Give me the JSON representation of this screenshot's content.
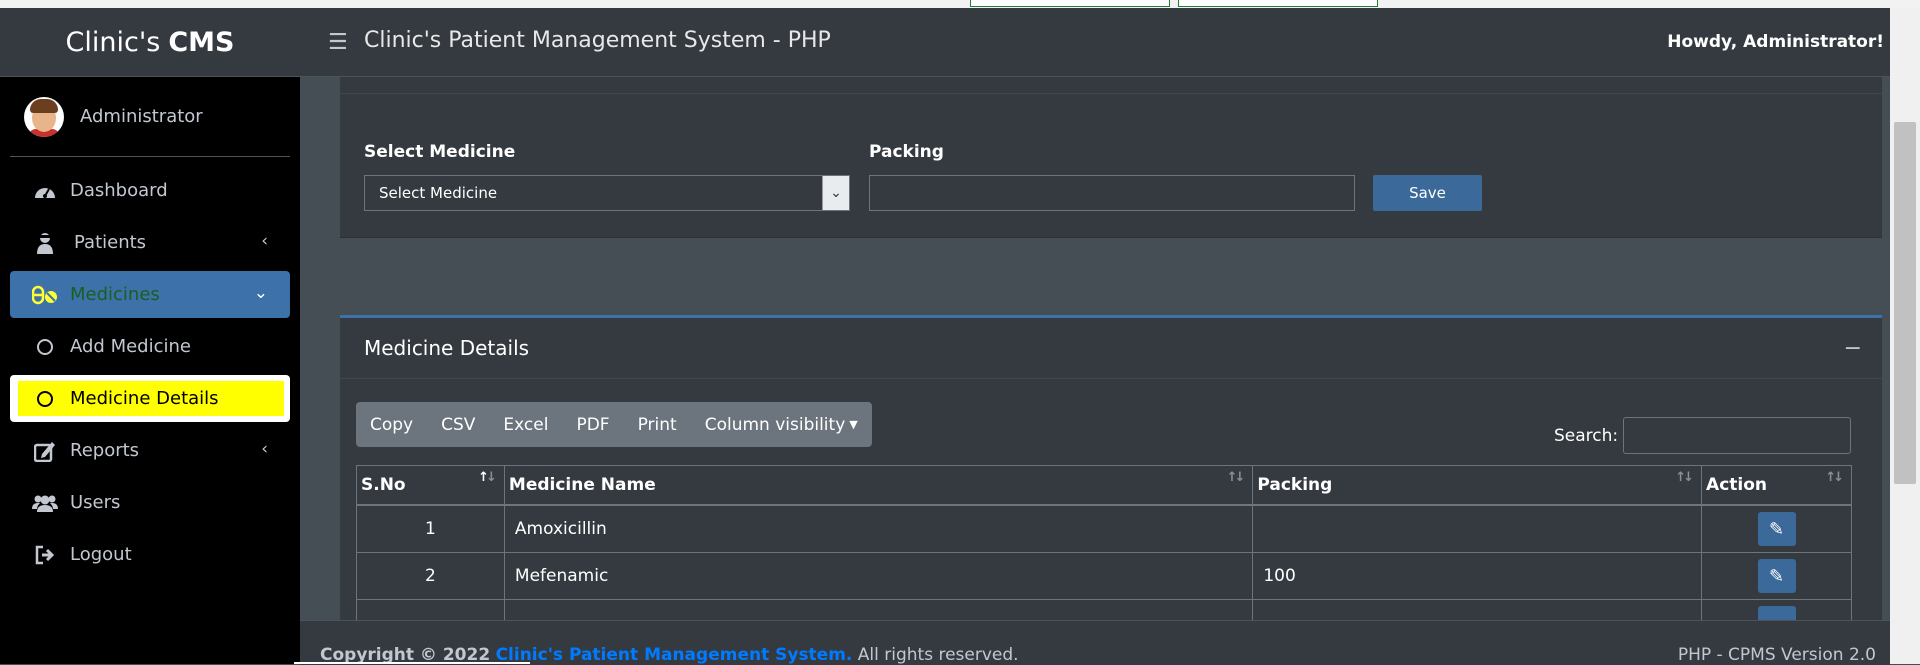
{
  "brand": {
    "name": "Clinic's",
    "bold": "CMS"
  },
  "user": {
    "name": "Administrator"
  },
  "header": {
    "title": "Clinic's Patient Management System - PHP",
    "greeting": "Howdy, Administrator!"
  },
  "sidebar": {
    "items": [
      {
        "label": "Dashboard"
      },
      {
        "label": "Patients"
      },
      {
        "label": "Medicines"
      },
      {
        "label": "Add Medicine"
      },
      {
        "label": "Medicine Details"
      },
      {
        "label": "Reports"
      },
      {
        "label": "Users"
      },
      {
        "label": "Logout"
      }
    ]
  },
  "form": {
    "medicine_label": "Select Medicine",
    "medicine_selected": "Select Medicine",
    "packing_label": "Packing",
    "packing_value": "",
    "save_label": "Save"
  },
  "details": {
    "title": "Medicine Details",
    "buttons": [
      "Copy",
      "CSV",
      "Excel",
      "PDF",
      "Print",
      "Column visibility"
    ],
    "search_label": "Search:",
    "columns": [
      "S.No",
      "Medicine Name",
      "Packing",
      "Action"
    ],
    "rows": [
      {
        "sno": "1",
        "name": "Amoxicillin",
        "packing": ""
      },
      {
        "sno": "2",
        "name": "Mefenamic",
        "packing": "100"
      }
    ]
  },
  "footer": {
    "copyright": "Copyright © 2022",
    "link": "Clinic's Patient Management System.",
    "rights": "All rights reserved.",
    "version": "PHP - CPMS Version 2.0"
  },
  "colors": {
    "accent": "#3c71aa",
    "highlight": "#ffff00",
    "sidebar": "#000000",
    "panel": "#343a40"
  }
}
